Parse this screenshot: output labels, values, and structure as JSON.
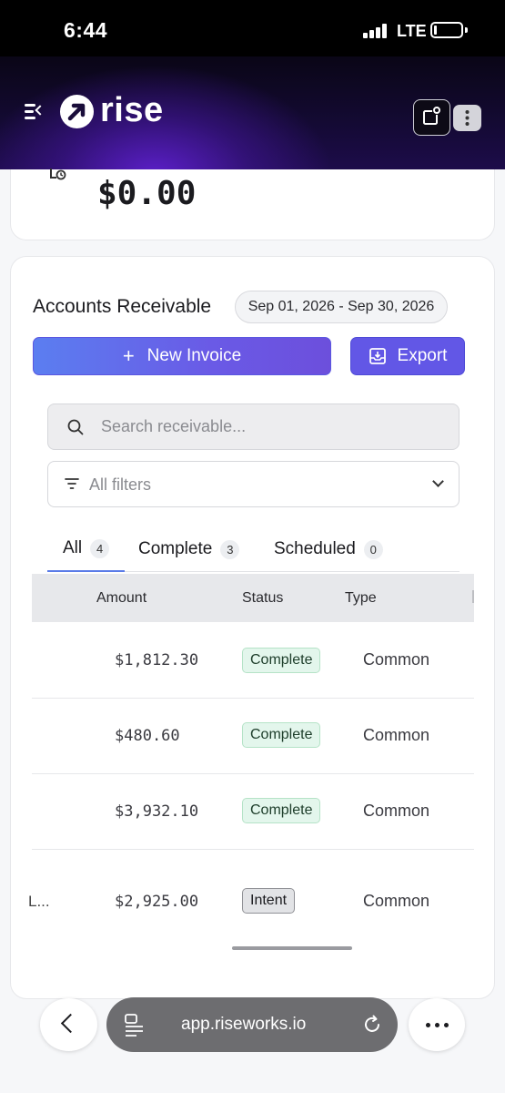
{
  "status_bar": {
    "time": "6:44",
    "network": "LTE"
  },
  "header": {
    "brand": "rise"
  },
  "balance": {
    "value": "$0.00"
  },
  "receivables": {
    "title": "Accounts Receivable",
    "date_range": "Sep 01, 2026 - Sep 30, 2026",
    "new_invoice_label": "New Invoice",
    "export_label": "Export",
    "search_placeholder": "Search receivable...",
    "filter_label": "All filters",
    "tabs": [
      {
        "label": "All",
        "count": "4"
      },
      {
        "label": "Complete",
        "count": "3"
      },
      {
        "label": "Scheduled",
        "count": "0"
      }
    ],
    "columns": [
      "Amount",
      "Status",
      "Type"
    ],
    "rows": [
      {
        "lead": "",
        "amount": "$1,812.30",
        "status": "Complete",
        "type": "Common"
      },
      {
        "lead": "",
        "amount": "$480.60",
        "status": "Complete",
        "type": "Common"
      },
      {
        "lead": "",
        "amount": "$3,932.10",
        "status": "Complete",
        "type": "Common"
      },
      {
        "lead": "L...",
        "amount": "$2,925.00",
        "status": "Intent",
        "type": "Common"
      }
    ]
  },
  "browser": {
    "url": "app.riseworks.io"
  }
}
